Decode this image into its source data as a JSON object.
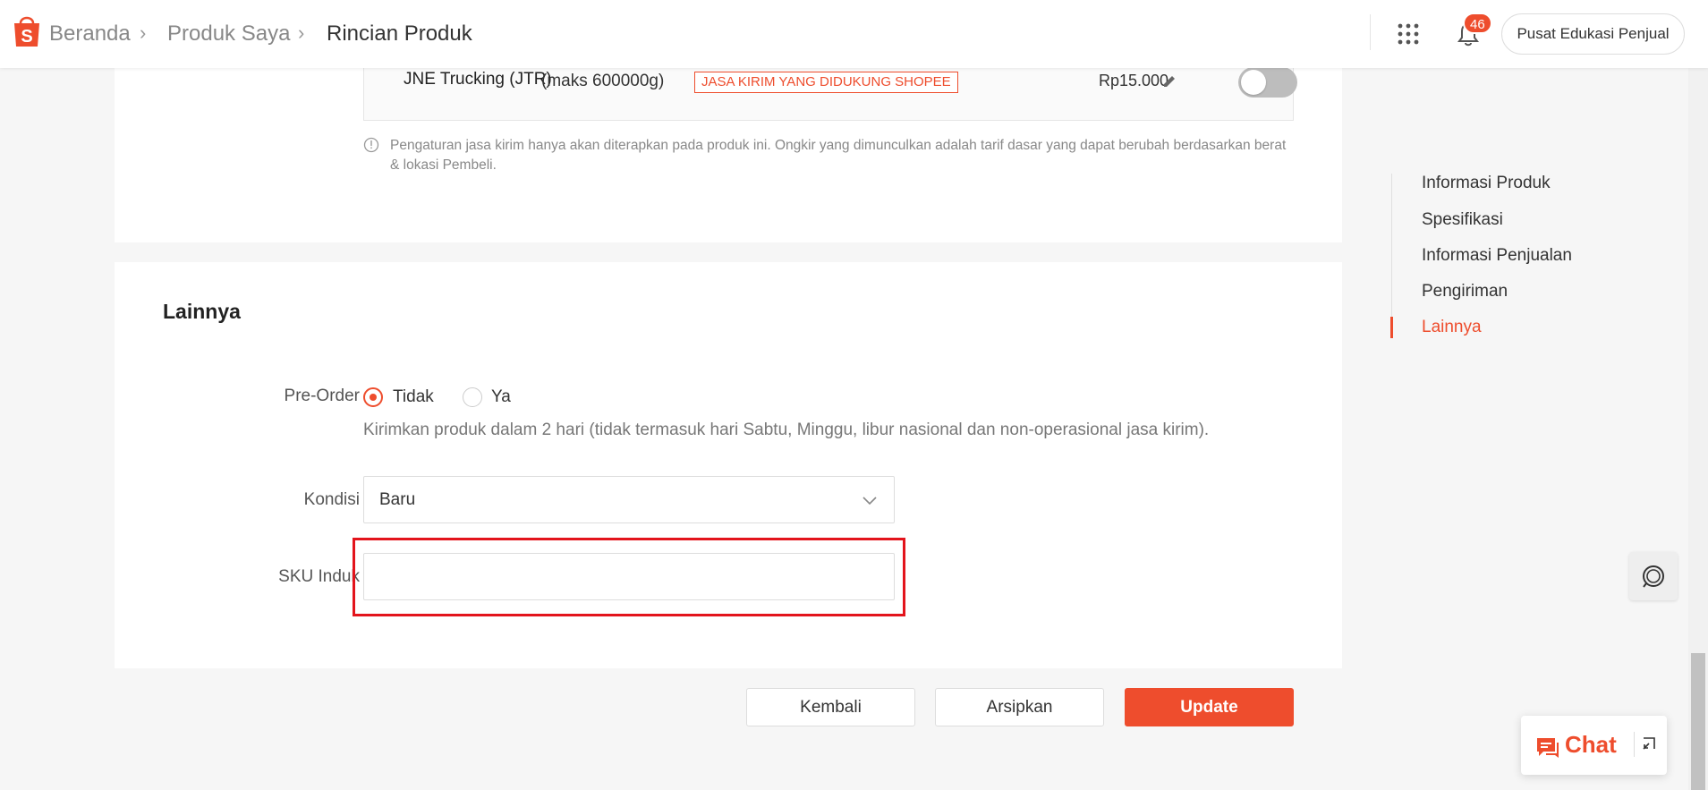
{
  "colors": {
    "accent": "#ee4d2d",
    "highlight": "#e3141c"
  },
  "header": {
    "logo_icon": "shopee-bag-icon",
    "breadcrumb": [
      "Beranda",
      "Produk Saya",
      "Rincian Produk"
    ],
    "apps_icon": "grid-apps-icon",
    "bell_icon": "bell-icon",
    "notification_count": "46",
    "edu_button": "Pusat Edukasi Penjual"
  },
  "shipping": {
    "courier_name": "JNE Trucking (JTR)",
    "max_weight": "(maks 600000g)",
    "tag": "JASA KIRIM YANG DIDUKUNG SHOPEE",
    "price": "Rp15.000",
    "enabled": false,
    "note": "Pengaturan jasa kirim hanya akan diterapkan pada produk ini. Ongkir yang dimunculkan adalah tarif dasar yang dapat berubah berdasarkan berat & lokasi Pembeli."
  },
  "lainnya": {
    "title": "Lainnya",
    "preorder": {
      "label": "Pre-Order",
      "options": [
        "Tidak",
        "Ya"
      ],
      "selected": "Tidak",
      "help": "Kirimkan produk dalam 2 hari (tidak termasuk hari Sabtu, Minggu, libur nasional dan non-operasional jasa kirim)."
    },
    "kondisi": {
      "label": "Kondisi",
      "value": "Baru"
    },
    "sku": {
      "label": "SKU Induk",
      "value": ""
    }
  },
  "actions": {
    "back": "Kembali",
    "archive": "Arsipkan",
    "update": "Update"
  },
  "side_nav": {
    "items": [
      "Informasi Produk",
      "Spesifikasi",
      "Informasi Penjualan",
      "Pengiriman",
      "Lainnya"
    ],
    "active": "Lainnya"
  },
  "chat": {
    "label": "Chat",
    "icon": "chat-bubble-icon",
    "minimize_icon": "minimize-icon"
  },
  "support_icon": "headset-icon"
}
